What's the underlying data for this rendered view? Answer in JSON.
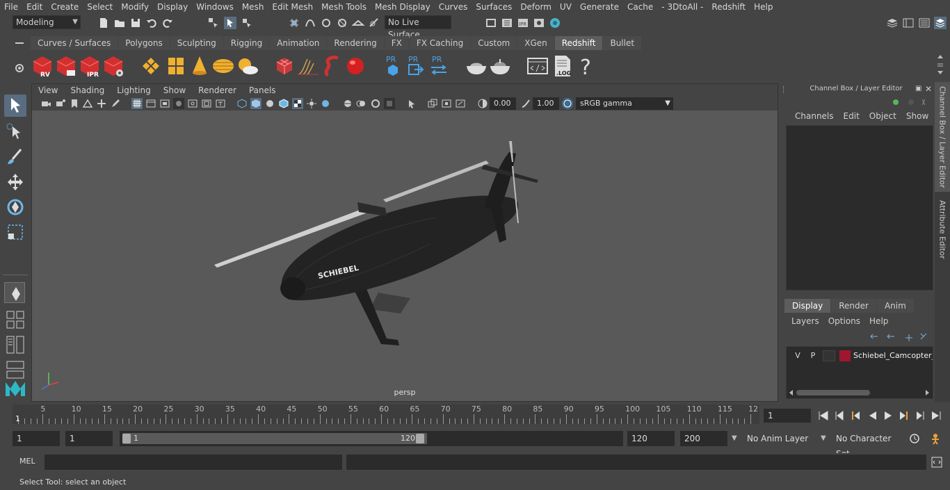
{
  "menubar": [
    "File",
    "Edit",
    "Create",
    "Select",
    "Modify",
    "Display",
    "Windows",
    "Mesh",
    "Edit Mesh",
    "Mesh Tools",
    "Mesh Display",
    "Curves",
    "Surfaces",
    "Deform",
    "UV",
    "Generate",
    "Cache",
    "- 3DtoAll -",
    "Redshift",
    "Help"
  ],
  "status": {
    "mode": "Modeling",
    "live_surface": "No Live Surface"
  },
  "shelf_tabs": [
    "Curves / Surfaces",
    "Polygons",
    "Sculpting",
    "Rigging",
    "Animation",
    "Rendering",
    "FX",
    "FX Caching",
    "Custom",
    "XGen",
    "Redshift",
    "Bullet"
  ],
  "shelf_active": "Redshift",
  "shelf_labels": {
    "rv": "RV",
    "ipr": "IPR",
    "pr": "PR",
    "log": ".LOG",
    "help": "?"
  },
  "viewport": {
    "menu": [
      "View",
      "Shading",
      "Lighting",
      "Show",
      "Renderer",
      "Panels"
    ],
    "exposure": "0.00",
    "gamma": "1.00",
    "color_space": "sRGB gamma",
    "camera_label": "persp",
    "model_text": "SCHIEBEL"
  },
  "channel_box": {
    "title": "Channel Box / Layer Editor",
    "menu": [
      "Channels",
      "Edit",
      "Object",
      "Show"
    ]
  },
  "layer_editor": {
    "tabs": [
      "Display",
      "Render",
      "Anim"
    ],
    "active_tab": "Display",
    "menu": [
      "Layers",
      "Options",
      "Help"
    ],
    "layer": {
      "v": "V",
      "p": "P",
      "name": "Schiebel_Camcopter_S",
      "color": "#a0162e"
    }
  },
  "side_tabs": [
    "Channel Box / Layer Editor",
    "Attribute Editor"
  ],
  "timeline": {
    "ticks": [
      "5",
      "10",
      "15",
      "20",
      "25",
      "30",
      "35",
      "40",
      "45",
      "50",
      "55",
      "60",
      "65",
      "70",
      "75",
      "80",
      "85",
      "90",
      "95",
      "100",
      "105",
      "110",
      "115",
      "12"
    ],
    "start_label": "1",
    "current_frame": "1"
  },
  "range": {
    "start": "1",
    "playback_start": "1",
    "slider_start": "1",
    "slider_end": "120",
    "playback_end": "120",
    "end": "200",
    "anim_layer": "No Anim Layer",
    "char_set": "No Character Set"
  },
  "cmd": {
    "lang": "MEL"
  },
  "help_line": "Select Tool: select an object"
}
